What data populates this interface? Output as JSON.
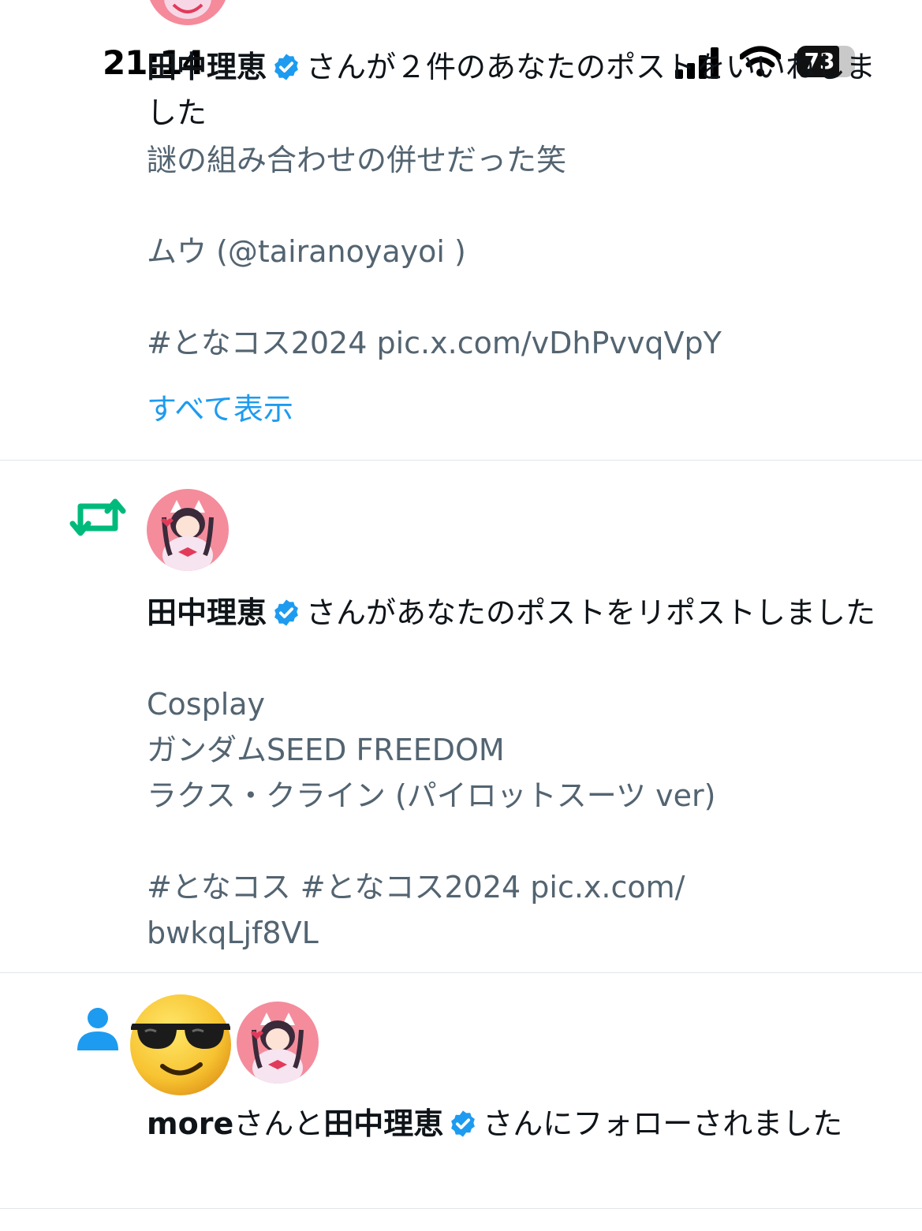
{
  "status_bar": {
    "time": "21:14",
    "battery": "73",
    "battery_level": 0.73,
    "icons": [
      "cellular-signal-icon",
      "wifi-icon",
      "battery-icon"
    ]
  },
  "colors": {
    "verified": "#1d9bf0",
    "retweet": "#00ba7c",
    "follow": "#1d9bf0",
    "link": "#1d9bf0",
    "muted_text": "#536471"
  },
  "notifications": [
    {
      "type": "like",
      "actor_name": "田中理恵",
      "action_text": "さんが２件のあなたのポストをいいねしました",
      "body": "謎の組み合わせの併せだった笑\n\nムウ (@tairanoyayoi )\n\n #となコス2024 pic.x.com/vDhPvvqVpY",
      "show_all": "すべて表示"
    },
    {
      "type": "repost",
      "icon": "retweet-icon",
      "actor_name": "田中理恵",
      "action_text": "さんがあなたのポストをリポストしました",
      "body": "Cosplay\nガンダムSEED FREEDOM\nラクス・クライン (パイロットスーツ ver)\n\n#となコス #となコス2024 pic.x.com/\nbwkqLjf8VL"
    },
    {
      "type": "follow",
      "icon": "person-icon",
      "actor1_name": "more",
      "joiner": "さんと",
      "actor2_name": "田中理恵",
      "action_text": "さんにフォローされました",
      "avatar1": "sunglasses-emoji-avatar"
    }
  ]
}
